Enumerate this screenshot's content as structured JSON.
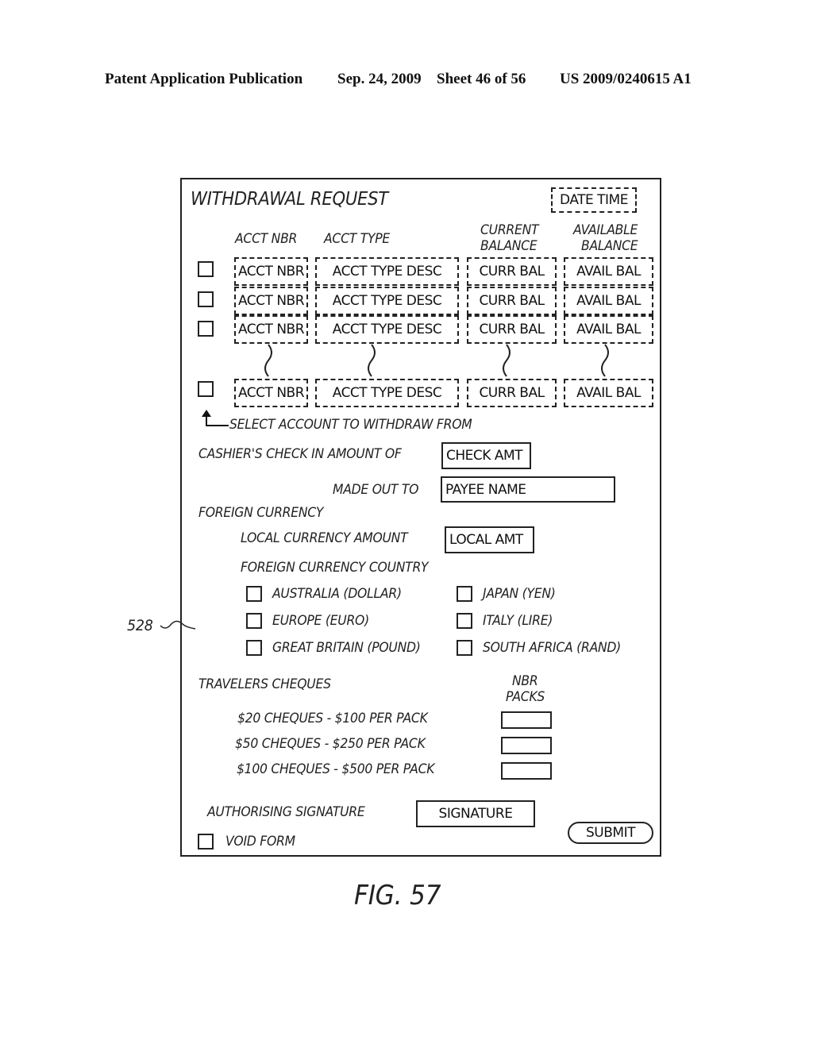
{
  "header": {
    "publication": "Patent Application Publication",
    "date": "Sep. 24, 2009",
    "sheet": "Sheet 46 of 56",
    "number": "US 2009/0240615 A1"
  },
  "form": {
    "title": "WITHDRAWAL REQUEST",
    "date_time": "DATE TIME",
    "columns": {
      "acct_nbr": "ACCT NBR",
      "acct_type": "ACCT TYPE",
      "current_balance_1": "CURRENT",
      "current_balance_2": "BALANCE",
      "available_balance_1": "AVAILABLE",
      "available_balance_2": "BALANCE"
    },
    "rows": [
      {
        "acct_nbr": "ACCT NBR",
        "acct_type": "ACCT TYPE DESC",
        "curr_bal": "CURR BAL",
        "avail_bal": "AVAIL BAL"
      },
      {
        "acct_nbr": "ACCT NBR",
        "acct_type": "ACCT TYPE DESC",
        "curr_bal": "CURR BAL",
        "avail_bal": "AVAIL BAL"
      },
      {
        "acct_nbr": "ACCT NBR",
        "acct_type": "ACCT TYPE DESC",
        "curr_bal": "CURR BAL",
        "avail_bal": "AVAIL BAL"
      },
      {
        "acct_nbr": "ACCT NBR",
        "acct_type": "ACCT TYPE DESC",
        "curr_bal": "CURR BAL",
        "avail_bal": "AVAIL BAL"
      }
    ],
    "select_hint": "SELECT ACCOUNT TO WITHDRAW FROM",
    "cashiers_check_label": "CASHIER'S CHECK IN AMOUNT OF",
    "check_amt": "CHECK AMT",
    "made_out_to_label": "MADE OUT TO",
    "payee_name": "PAYEE NAME",
    "foreign_currency_label": "FOREIGN CURRENCY",
    "local_currency_amount_label": "LOCAL CURRENCY AMOUNT",
    "local_amt": "LOCAL AMT",
    "foreign_currency_country_label": "FOREIGN CURRENCY COUNTRY",
    "countries": [
      "AUSTRALIA (DOLLAR)",
      "JAPAN (YEN)",
      "EUROPE (EURO)",
      "ITALY (LIRE)",
      "GREAT BRITAIN (POUND)",
      "SOUTH AFRICA (RAND)"
    ],
    "travelers_cheques_label": "TRAVELERS CHEQUES",
    "nbr_packs_1": "NBR",
    "nbr_packs_2": "PACKS",
    "cheques": [
      "$20 CHEQUES - $100 PER PACK",
      "$50 CHEQUES - $250 PER PACK",
      "$100 CHEQUES - $500 PER PACK"
    ],
    "authorising_signature_label": "AUTHORISING SIGNATURE",
    "signature": "SIGNATURE",
    "void_form_label": "VOID FORM",
    "submit_label": "SUBMIT"
  },
  "reference_numeral": "528",
  "figure_label": "FIG. 57"
}
